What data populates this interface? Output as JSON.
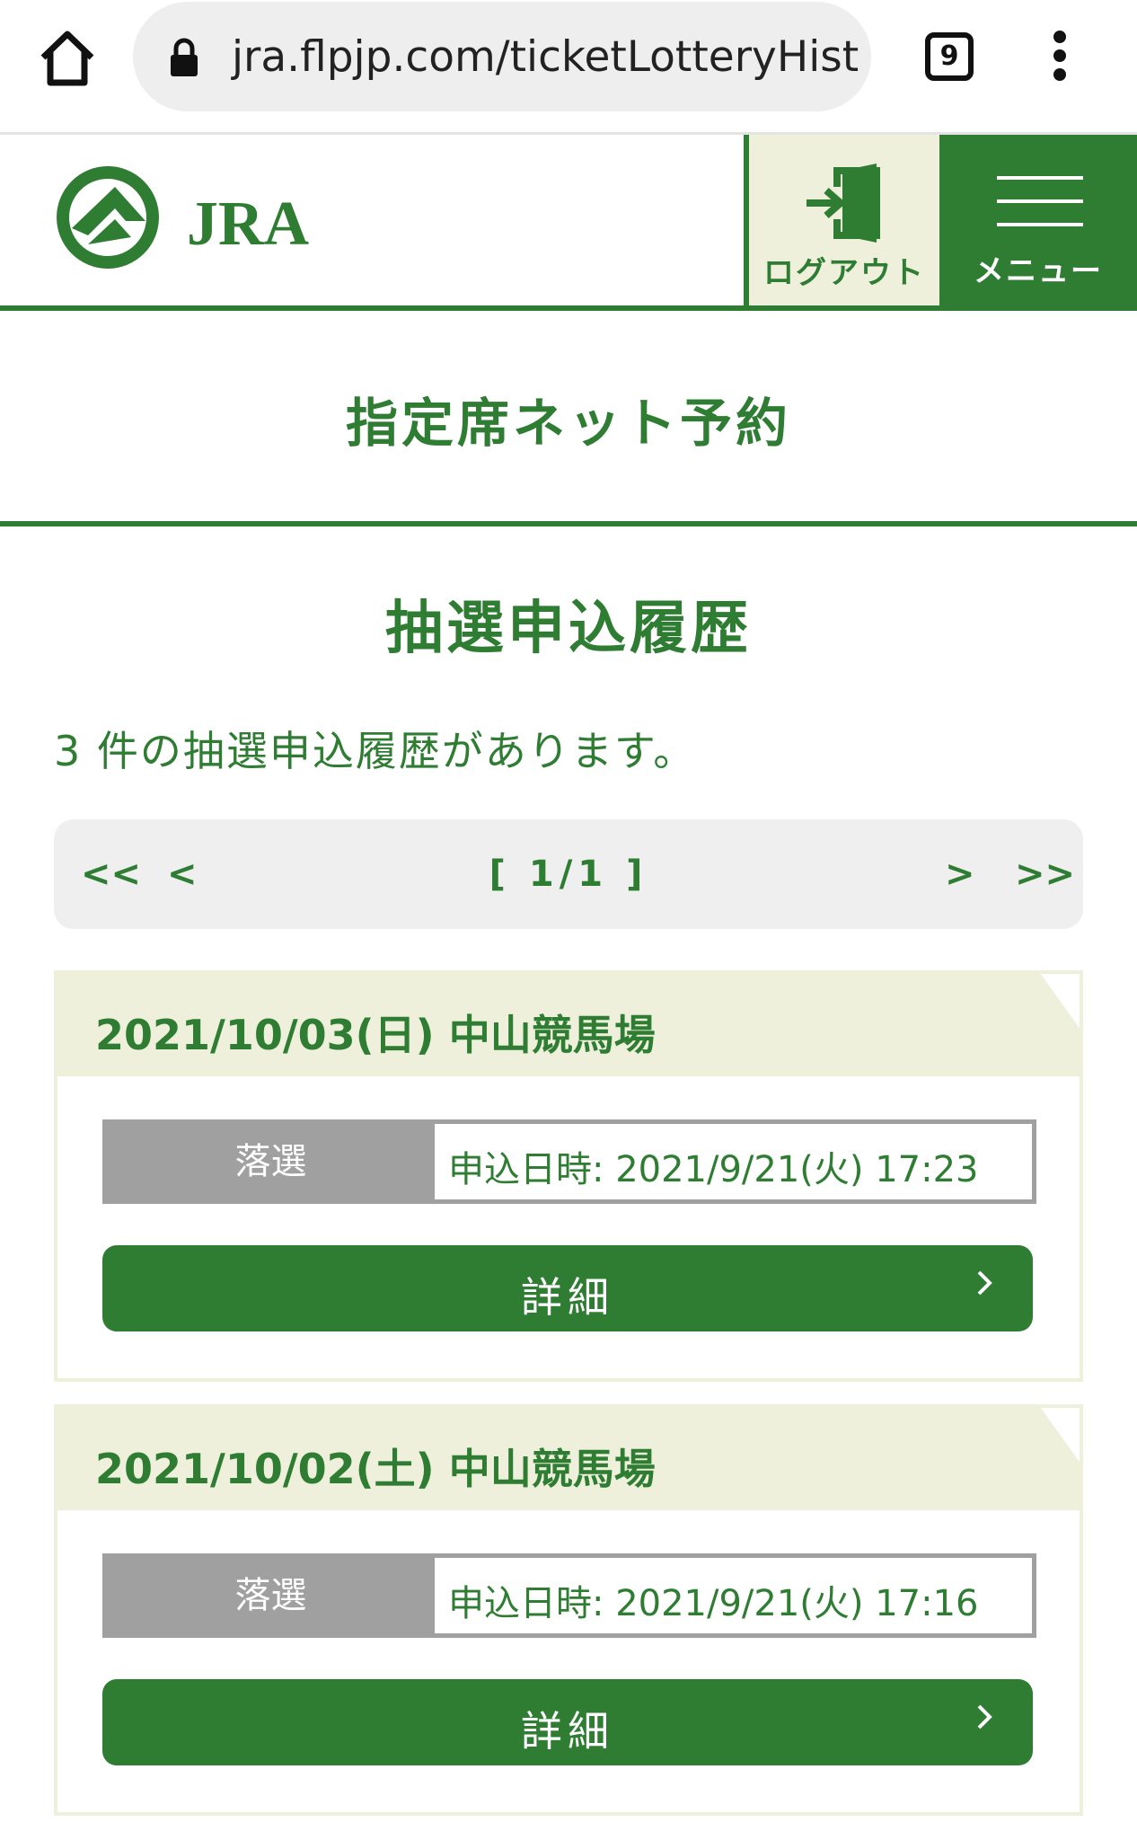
{
  "browser": {
    "url": "jra.flpjp.com/ticketLotteryHist",
    "tab_count": "9"
  },
  "header": {
    "logo_text": "JRA",
    "logout_label": "ログアウト",
    "menu_label": "メニュー"
  },
  "service_title": "指定席ネット予約",
  "page_title": "抽選申込履歴",
  "result_count": "3 件の抽選申込履歴があります。",
  "pagination": {
    "first": "<<",
    "prev": "<",
    "current": "[ 1/1 ]",
    "next": ">",
    "last": ">>"
  },
  "entries": [
    {
      "date_venue": "2021/10/03(日) 中山競馬場",
      "status": "落選",
      "applied_at": "申込日時: 2021/9/21(火) 17:23",
      "detail_label": "詳細"
    },
    {
      "date_venue": "2021/10/02(土) 中山競馬場",
      "status": "落選",
      "applied_at": "申込日時: 2021/9/21(火) 17:16",
      "detail_label": "詳細"
    }
  ],
  "colors": {
    "brand_green": "#2e7d32",
    "card_header_bg": "#eef0dc",
    "status_gray": "#a0a0a0"
  }
}
